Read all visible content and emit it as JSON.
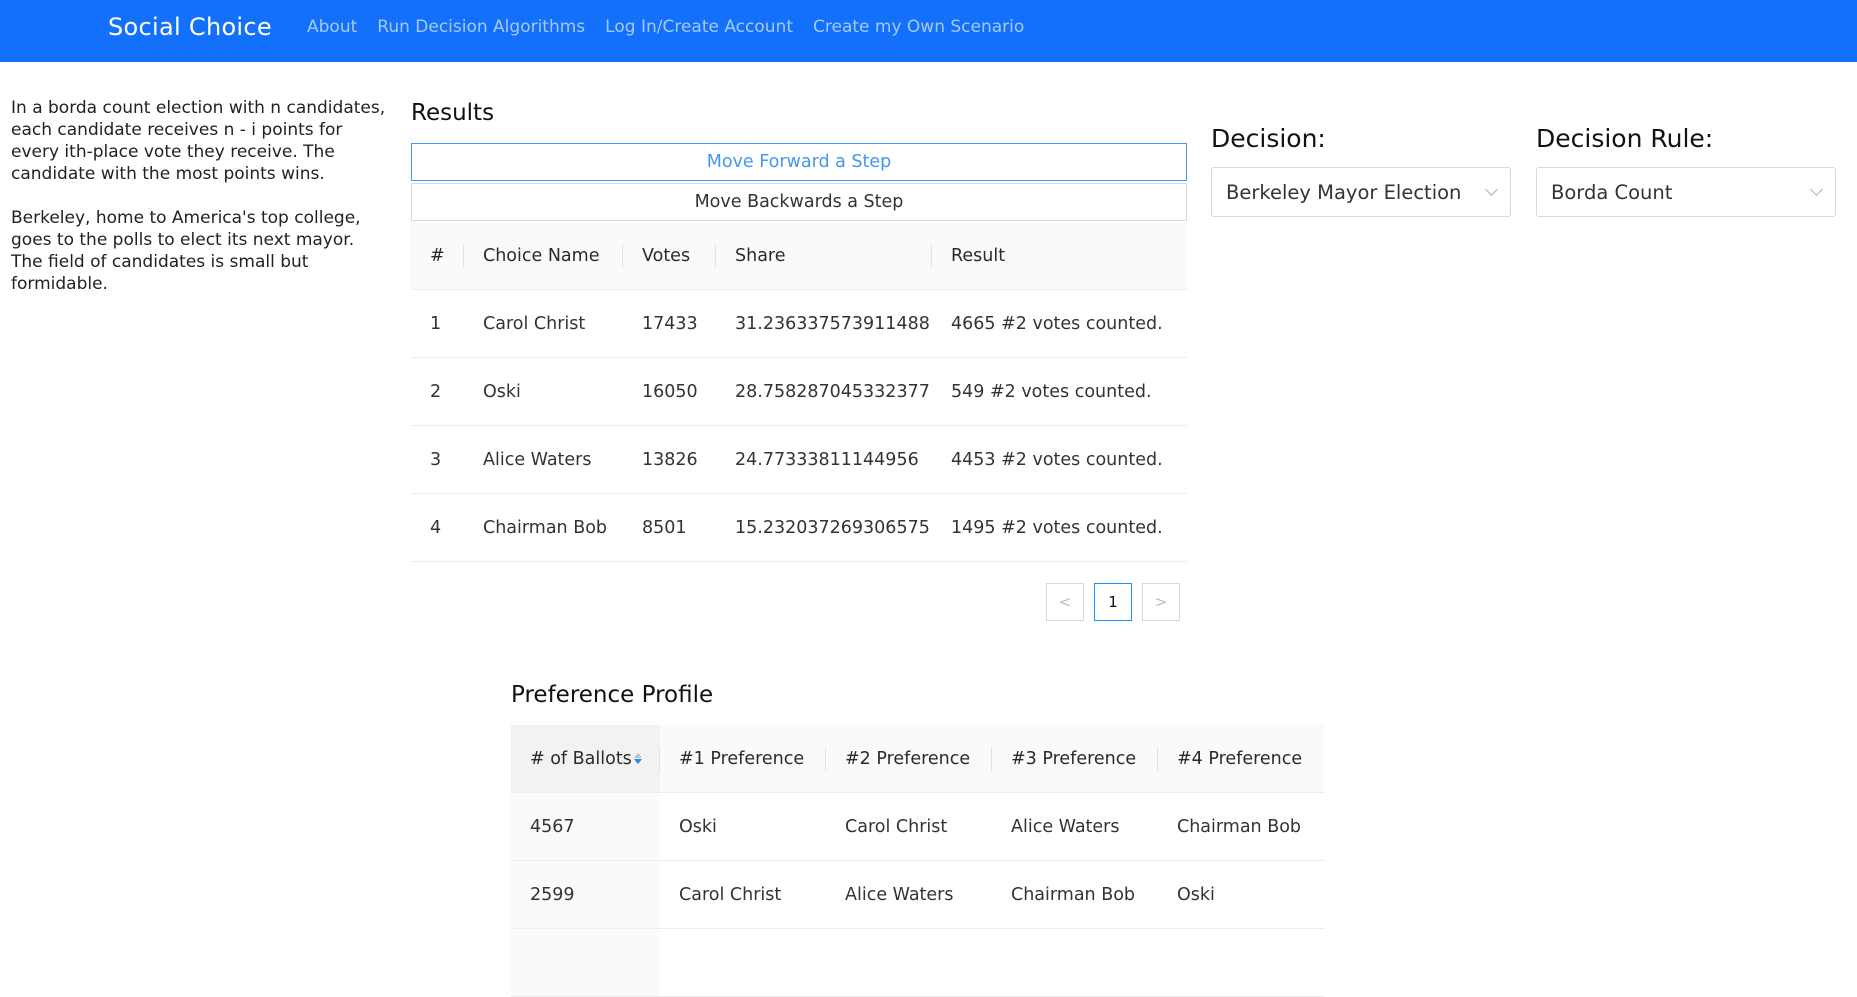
{
  "navbar": {
    "brand": "Social Choice",
    "links": [
      "About",
      "Run Decision Algorithms",
      "Log In/Create Account",
      "Create my Own Scenario"
    ]
  },
  "intro": {
    "paragraphs": [
      "In a borda count election with n candidates, each candidate receives n - i points for every ith-place vote they receive. The candidate with the most points wins.",
      "Berkeley, home to America's top college, goes to the polls to elect its next mayor. The field of candidates is small but formidable."
    ]
  },
  "results": {
    "title": "Results",
    "forward_label": "Move Forward a Step",
    "backward_label": "Move Backwards a Step",
    "columns": [
      "#",
      "Choice Name",
      "Votes",
      "Share",
      "Result"
    ],
    "rows": [
      [
        "1",
        "Carol Christ",
        "17433",
        "31.236337573911488",
        "4665 #2 votes counted."
      ],
      [
        "2",
        "Oski",
        "16050",
        "28.758287045332377",
        "549 #2 votes counted."
      ],
      [
        "3",
        "Alice Waters",
        "13826",
        "24.77333811144956",
        "4453 #2 votes counted."
      ],
      [
        "4",
        "Chairman Bob",
        "8501",
        "15.232037269306575",
        "1495 #2 votes counted."
      ]
    ]
  },
  "pagination": {
    "prev": "<",
    "current": "1",
    "next": ">"
  },
  "preference_profile": {
    "title": "Preference Profile",
    "columns": [
      "# of Ballots",
      "#1 Preference",
      "#2 Preference",
      "#3 Preference",
      "#4 Preference"
    ],
    "rows": [
      [
        "4567",
        "Oski",
        "Carol Christ",
        "Alice Waters",
        "Chairman Bob"
      ],
      [
        "2599",
        "Carol Christ",
        "Alice Waters",
        "Chairman Bob",
        "Oski"
      ]
    ]
  },
  "decision": {
    "label": "Decision:",
    "value": "Berkeley Mayor Election"
  },
  "decision_rule": {
    "label": "Decision Rule:",
    "value": "Borda Count"
  },
  "colors": {
    "navbar": "#1270fa",
    "accent": "#1890ff"
  }
}
